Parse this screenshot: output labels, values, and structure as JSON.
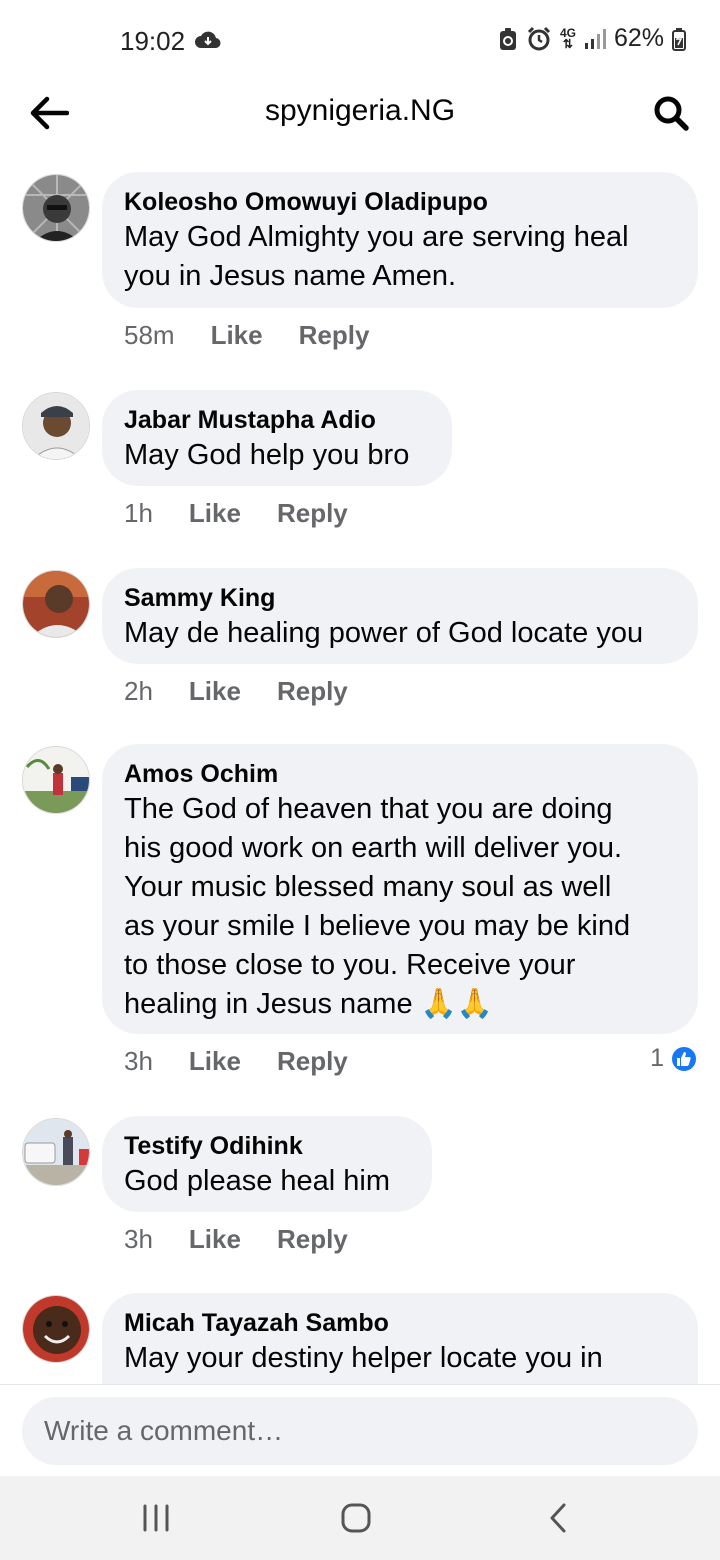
{
  "status_bar": {
    "time": "19:02",
    "network": "4G",
    "battery": "62%"
  },
  "header": {
    "title": "spynigeria.NG",
    "back_icon": "arrow-left-icon",
    "search_icon": "search-icon"
  },
  "comments": [
    {
      "author": "Koleosho Omowuyi Oladipupo",
      "lines": [
        "May God Almighty you are serving heal",
        "you in Jesus name Amen."
      ],
      "time": "58m",
      "like": "Like",
      "reply": "Reply"
    },
    {
      "author": "Jabar Mustapha Adio",
      "lines": [
        "May God help you bro"
      ],
      "time": "1h",
      "like": "Like",
      "reply": "Reply"
    },
    {
      "author": "Sammy King",
      "lines": [
        "May de healing power of God locate you"
      ],
      "time": "2h",
      "like": "Like",
      "reply": "Reply"
    },
    {
      "author": "Amos Ochim",
      "lines": [
        "The God of heaven that you are doing",
        "his good work on earth will deliver you.",
        "Your music blessed many soul as well",
        "as your smile I believe you may be kind",
        "to those close to you. Receive your",
        "healing in Jesus name 🙏🙏"
      ],
      "time": "3h",
      "like": "Like",
      "reply": "Reply",
      "reaction_count": "1"
    },
    {
      "author": "Testify Odihink",
      "lines": [
        "God please heal him"
      ],
      "time": "3h",
      "like": "Like",
      "reply": "Reply"
    },
    {
      "author": "Micah Tayazah Sambo",
      "lines": [
        "May your destiny helper locate you in"
      ],
      "time": "",
      "like": "",
      "reply": ""
    }
  ],
  "composer": {
    "placeholder": "Write a comment…"
  },
  "navbar": {
    "recents_icon": "recents-icon",
    "home_icon": "home-icon",
    "back_icon": "nav-back-icon"
  }
}
